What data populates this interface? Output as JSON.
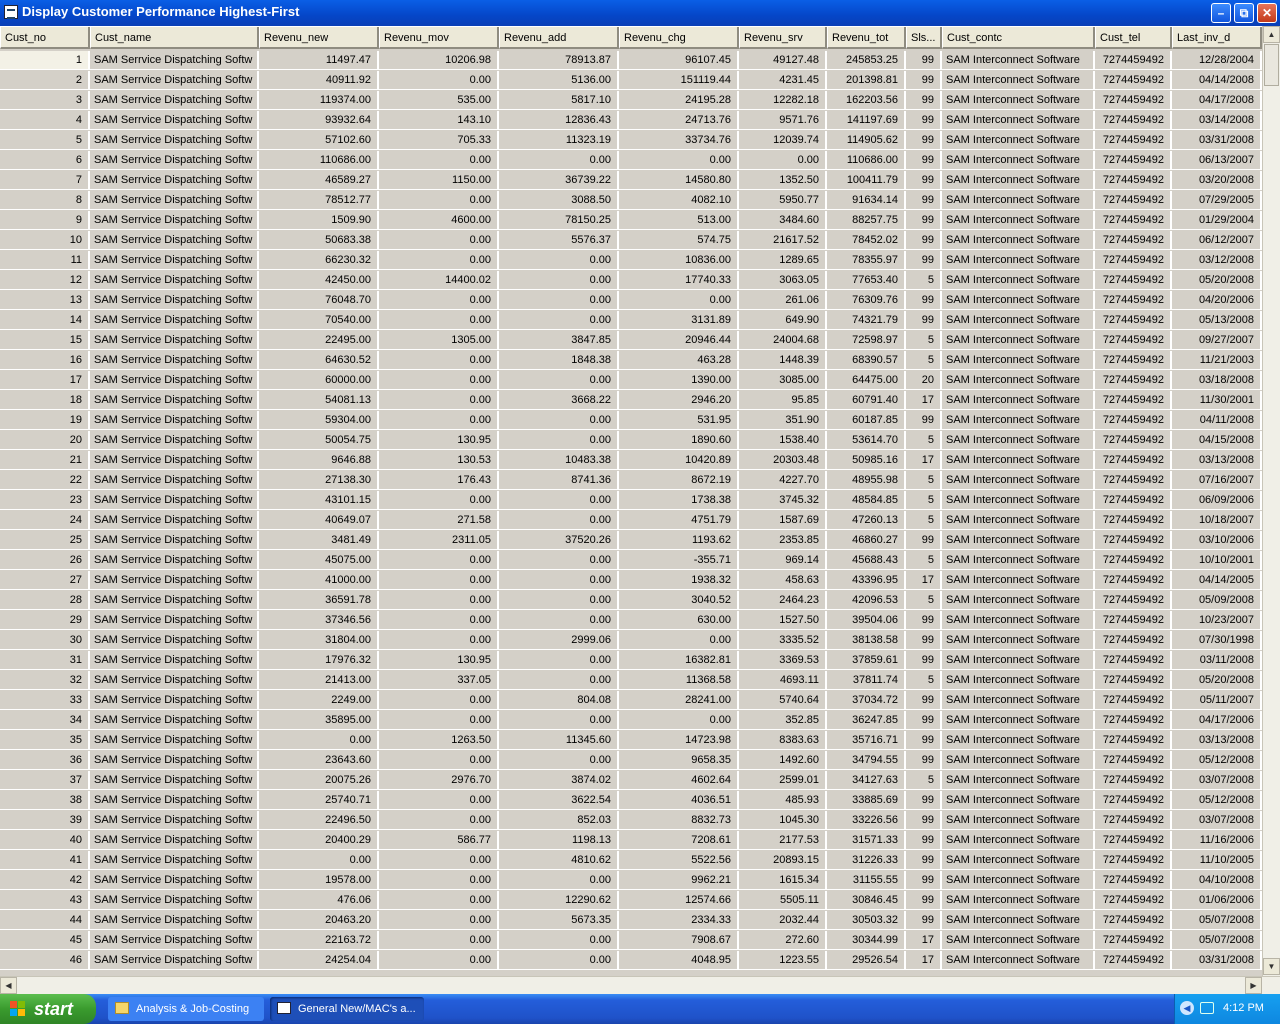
{
  "window": {
    "title": "Display Customer Performance Highest-First"
  },
  "columns": [
    "Cust_no",
    "Cust_name",
    "Revenu_new",
    "Revenu_mov",
    "Revenu_add",
    "Revenu_chg",
    "Revenu_srv",
    "Revenu_tot",
    "Sls...",
    "Cust_contc",
    "Cust_tel",
    "Last_inv_d"
  ],
  "rows": [
    [
      "1",
      "SAM Serrvice Dispatching Softw",
      "11497.47",
      "10206.98",
      "78913.87",
      "96107.45",
      "49127.48",
      "245853.25",
      "99",
      "SAM Interconnect Software",
      "7274459492",
      "12/28/2004"
    ],
    [
      "2",
      "SAM Serrvice Dispatching Softw",
      "40911.92",
      "0.00",
      "5136.00",
      "151119.44",
      "4231.45",
      "201398.81",
      "99",
      "SAM Interconnect Software",
      "7274459492",
      "04/14/2008"
    ],
    [
      "3",
      "SAM Serrvice Dispatching Softw",
      "119374.00",
      "535.00",
      "5817.10",
      "24195.28",
      "12282.18",
      "162203.56",
      "99",
      "SAM Interconnect Software",
      "7274459492",
      "04/17/2008"
    ],
    [
      "4",
      "SAM Serrvice Dispatching Softw",
      "93932.64",
      "143.10",
      "12836.43",
      "24713.76",
      "9571.76",
      "141197.69",
      "99",
      "SAM Interconnect Software",
      "7274459492",
      "03/14/2008"
    ],
    [
      "5",
      "SAM Serrvice Dispatching Softw",
      "57102.60",
      "705.33",
      "11323.19",
      "33734.76",
      "12039.74",
      "114905.62",
      "99",
      "SAM Interconnect Software",
      "7274459492",
      "03/31/2008"
    ],
    [
      "6",
      "SAM Serrvice Dispatching Softw",
      "110686.00",
      "0.00",
      "0.00",
      "0.00",
      "0.00",
      "110686.00",
      "99",
      "SAM Interconnect Software",
      "7274459492",
      "06/13/2007"
    ],
    [
      "7",
      "SAM Serrvice Dispatching Softw",
      "46589.27",
      "1150.00",
      "36739.22",
      "14580.80",
      "1352.50",
      "100411.79",
      "99",
      "SAM Interconnect Software",
      "7274459492",
      "03/20/2008"
    ],
    [
      "8",
      "SAM Serrvice Dispatching Softw",
      "78512.77",
      "0.00",
      "3088.50",
      "4082.10",
      "5950.77",
      "91634.14",
      "99",
      "SAM Interconnect Software",
      "7274459492",
      "07/29/2005"
    ],
    [
      "9",
      "SAM Serrvice Dispatching Softw",
      "1509.90",
      "4600.00",
      "78150.25",
      "513.00",
      "3484.60",
      "88257.75",
      "99",
      "SAM Interconnect Software",
      "7274459492",
      "01/29/2004"
    ],
    [
      "10",
      "SAM Serrvice Dispatching Softw",
      "50683.38",
      "0.00",
      "5576.37",
      "574.75",
      "21617.52",
      "78452.02",
      "99",
      "SAM Interconnect Software",
      "7274459492",
      "06/12/2007"
    ],
    [
      "11",
      "SAM Serrvice Dispatching Softw",
      "66230.32",
      "0.00",
      "0.00",
      "10836.00",
      "1289.65",
      "78355.97",
      "99",
      "SAM Interconnect Software",
      "7274459492",
      "03/12/2008"
    ],
    [
      "12",
      "SAM Serrvice Dispatching Softw",
      "42450.00",
      "14400.02",
      "0.00",
      "17740.33",
      "3063.05",
      "77653.40",
      "5",
      "SAM Interconnect Software",
      "7274459492",
      "05/20/2008"
    ],
    [
      "13",
      "SAM Serrvice Dispatching Softw",
      "76048.70",
      "0.00",
      "0.00",
      "0.00",
      "261.06",
      "76309.76",
      "99",
      "SAM Interconnect Software",
      "7274459492",
      "04/20/2006"
    ],
    [
      "14",
      "SAM Serrvice Dispatching Softw",
      "70540.00",
      "0.00",
      "0.00",
      "3131.89",
      "649.90",
      "74321.79",
      "99",
      "SAM Interconnect Software",
      "7274459492",
      "05/13/2008"
    ],
    [
      "15",
      "SAM Serrvice Dispatching Softw",
      "22495.00",
      "1305.00",
      "3847.85",
      "20946.44",
      "24004.68",
      "72598.97",
      "5",
      "SAM Interconnect Software",
      "7274459492",
      "09/27/2007"
    ],
    [
      "16",
      "SAM Serrvice Dispatching Softw",
      "64630.52",
      "0.00",
      "1848.38",
      "463.28",
      "1448.39",
      "68390.57",
      "5",
      "SAM Interconnect Software",
      "7274459492",
      "11/21/2003"
    ],
    [
      "17",
      "SAM Serrvice Dispatching Softw",
      "60000.00",
      "0.00",
      "0.00",
      "1390.00",
      "3085.00",
      "64475.00",
      "20",
      "SAM Interconnect Software",
      "7274459492",
      "03/18/2008"
    ],
    [
      "18",
      "SAM Serrvice Dispatching Softw",
      "54081.13",
      "0.00",
      "3668.22",
      "2946.20",
      "95.85",
      "60791.40",
      "17",
      "SAM Interconnect Software",
      "7274459492",
      "11/30/2001"
    ],
    [
      "19",
      "SAM Serrvice Dispatching Softw",
      "59304.00",
      "0.00",
      "0.00",
      "531.95",
      "351.90",
      "60187.85",
      "99",
      "SAM Interconnect Software",
      "7274459492",
      "04/11/2008"
    ],
    [
      "20",
      "SAM Serrvice Dispatching Softw",
      "50054.75",
      "130.95",
      "0.00",
      "1890.60",
      "1538.40",
      "53614.70",
      "5",
      "SAM Interconnect Software",
      "7274459492",
      "04/15/2008"
    ],
    [
      "21",
      "SAM Serrvice Dispatching Softw",
      "9646.88",
      "130.53",
      "10483.38",
      "10420.89",
      "20303.48",
      "50985.16",
      "17",
      "SAM Interconnect Software",
      "7274459492",
      "03/13/2008"
    ],
    [
      "22",
      "SAM Serrvice Dispatching Softw",
      "27138.30",
      "176.43",
      "8741.36",
      "8672.19",
      "4227.70",
      "48955.98",
      "5",
      "SAM Interconnect Software",
      "7274459492",
      "07/16/2007"
    ],
    [
      "23",
      "SAM Serrvice Dispatching Softw",
      "43101.15",
      "0.00",
      "0.00",
      "1738.38",
      "3745.32",
      "48584.85",
      "5",
      "SAM Interconnect Software",
      "7274459492",
      "06/09/2006"
    ],
    [
      "24",
      "SAM Serrvice Dispatching Softw",
      "40649.07",
      "271.58",
      "0.00",
      "4751.79",
      "1587.69",
      "47260.13",
      "5",
      "SAM Interconnect Software",
      "7274459492",
      "10/18/2007"
    ],
    [
      "25",
      "SAM Serrvice Dispatching Softw",
      "3481.49",
      "2311.05",
      "37520.26",
      "1193.62",
      "2353.85",
      "46860.27",
      "99",
      "SAM Interconnect Software",
      "7274459492",
      "03/10/2006"
    ],
    [
      "26",
      "SAM Serrvice Dispatching Softw",
      "45075.00",
      "0.00",
      "0.00",
      "-355.71",
      "969.14",
      "45688.43",
      "5",
      "SAM Interconnect Software",
      "7274459492",
      "10/10/2001"
    ],
    [
      "27",
      "SAM Serrvice Dispatching Softw",
      "41000.00",
      "0.00",
      "0.00",
      "1938.32",
      "458.63",
      "43396.95",
      "17",
      "SAM Interconnect Software",
      "7274459492",
      "04/14/2005"
    ],
    [
      "28",
      "SAM Serrvice Dispatching Softw",
      "36591.78",
      "0.00",
      "0.00",
      "3040.52",
      "2464.23",
      "42096.53",
      "5",
      "SAM Interconnect Software",
      "7274459492",
      "05/09/2008"
    ],
    [
      "29",
      "SAM Serrvice Dispatching Softw",
      "37346.56",
      "0.00",
      "0.00",
      "630.00",
      "1527.50",
      "39504.06",
      "99",
      "SAM Interconnect Software",
      "7274459492",
      "10/23/2007"
    ],
    [
      "30",
      "SAM Serrvice Dispatching Softw",
      "31804.00",
      "0.00",
      "2999.06",
      "0.00",
      "3335.52",
      "38138.58",
      "99",
      "SAM Interconnect Software",
      "7274459492",
      "07/30/1998"
    ],
    [
      "31",
      "SAM Serrvice Dispatching Softw",
      "17976.32",
      "130.95",
      "0.00",
      "16382.81",
      "3369.53",
      "37859.61",
      "99",
      "SAM Interconnect Software",
      "7274459492",
      "03/11/2008"
    ],
    [
      "32",
      "SAM Serrvice Dispatching Softw",
      "21413.00",
      "337.05",
      "0.00",
      "11368.58",
      "4693.11",
      "37811.74",
      "5",
      "SAM Interconnect Software",
      "7274459492",
      "05/20/2008"
    ],
    [
      "33",
      "SAM Serrvice Dispatching Softw",
      "2249.00",
      "0.00",
      "804.08",
      "28241.00",
      "5740.64",
      "37034.72",
      "99",
      "SAM Interconnect Software",
      "7274459492",
      "05/11/2007"
    ],
    [
      "34",
      "SAM Serrvice Dispatching Softw",
      "35895.00",
      "0.00",
      "0.00",
      "0.00",
      "352.85",
      "36247.85",
      "99",
      "SAM Interconnect Software",
      "7274459492",
      "04/17/2006"
    ],
    [
      "35",
      "SAM Serrvice Dispatching Softw",
      "0.00",
      "1263.50",
      "11345.60",
      "14723.98",
      "8383.63",
      "35716.71",
      "99",
      "SAM Interconnect Software",
      "7274459492",
      "03/13/2008"
    ],
    [
      "36",
      "SAM Serrvice Dispatching Softw",
      "23643.60",
      "0.00",
      "0.00",
      "9658.35",
      "1492.60",
      "34794.55",
      "99",
      "SAM Interconnect Software",
      "7274459492",
      "05/12/2008"
    ],
    [
      "37",
      "SAM Serrvice Dispatching Softw",
      "20075.26",
      "2976.70",
      "3874.02",
      "4602.64",
      "2599.01",
      "34127.63",
      "5",
      "SAM Interconnect Software",
      "7274459492",
      "03/07/2008"
    ],
    [
      "38",
      "SAM Serrvice Dispatching Softw",
      "25740.71",
      "0.00",
      "3622.54",
      "4036.51",
      "485.93",
      "33885.69",
      "99",
      "SAM Interconnect Software",
      "7274459492",
      "05/12/2008"
    ],
    [
      "39",
      "SAM Serrvice Dispatching Softw",
      "22496.50",
      "0.00",
      "852.03",
      "8832.73",
      "1045.30",
      "33226.56",
      "99",
      "SAM Interconnect Software",
      "7274459492",
      "03/07/2008"
    ],
    [
      "40",
      "SAM Serrvice Dispatching Softw",
      "20400.29",
      "586.77",
      "1198.13",
      "7208.61",
      "2177.53",
      "31571.33",
      "99",
      "SAM Interconnect Software",
      "7274459492",
      "11/16/2006"
    ],
    [
      "41",
      "SAM Serrvice Dispatching Softw",
      "0.00",
      "0.00",
      "4810.62",
      "5522.56",
      "20893.15",
      "31226.33",
      "99",
      "SAM Interconnect Software",
      "7274459492",
      "11/10/2005"
    ],
    [
      "42",
      "SAM Serrvice Dispatching Softw",
      "19578.00",
      "0.00",
      "0.00",
      "9962.21",
      "1615.34",
      "31155.55",
      "99",
      "SAM Interconnect Software",
      "7274459492",
      "04/10/2008"
    ],
    [
      "43",
      "SAM Serrvice Dispatching Softw",
      "476.06",
      "0.00",
      "12290.62",
      "12574.66",
      "5505.11",
      "30846.45",
      "99",
      "SAM Interconnect Software",
      "7274459492",
      "01/06/2006"
    ],
    [
      "44",
      "SAM Serrvice Dispatching Softw",
      "20463.20",
      "0.00",
      "5673.35",
      "2334.33",
      "2032.44",
      "30503.32",
      "99",
      "SAM Interconnect Software",
      "7274459492",
      "05/07/2008"
    ],
    [
      "45",
      "SAM Serrvice Dispatching Softw",
      "22163.72",
      "0.00",
      "0.00",
      "7908.67",
      "272.60",
      "30344.99",
      "17",
      "SAM Interconnect Software",
      "7274459492",
      "05/07/2008"
    ],
    [
      "46",
      "SAM Serrvice Dispatching Softw",
      "24254.04",
      "0.00",
      "0.00",
      "4048.95",
      "1223.55",
      "29526.54",
      "17",
      "SAM Interconnect Software",
      "7274459492",
      "03/31/2008"
    ]
  ],
  "taskbar": {
    "start_label": "start",
    "tasks": [
      "Analysis & Job-Costing",
      "General New/MAC's a..."
    ],
    "clock": "4:12 PM"
  }
}
